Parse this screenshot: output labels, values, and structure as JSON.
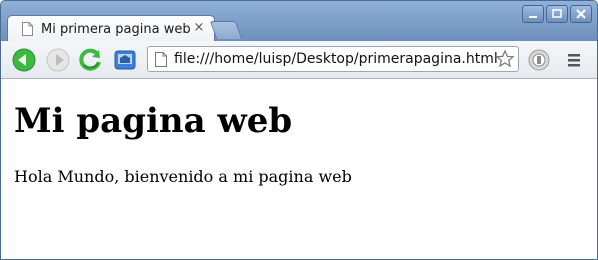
{
  "tab": {
    "title": "Mi primera pagina web",
    "close": "×"
  },
  "window_controls": {
    "minimize": "–",
    "maximize": "□",
    "close": "✕"
  },
  "toolbar": {
    "url": "file:///home/luisp/Desktop/primerapagina.html"
  },
  "page": {
    "heading": "Mi pagina web",
    "paragraph": "Hola Mundo, bienvenido a mi pagina web"
  },
  "icons": {
    "back": "back-arrow-icon",
    "forward": "forward-arrow-icon",
    "reload": "reload-icon",
    "home": "home-icon",
    "bookmark": "star-icon",
    "extension": "extension-icon",
    "menu": "wrench-menu-icon"
  },
  "colors": {
    "titlebar": "#7a9bc4",
    "toolbar": "#eef1f5",
    "back_button": "#3cb843"
  }
}
